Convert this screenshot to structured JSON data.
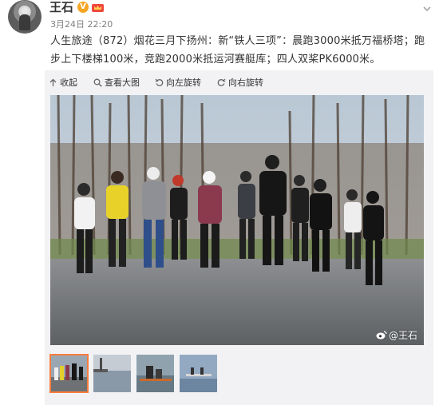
{
  "post": {
    "author": "王石",
    "verified_badge": "V",
    "timestamp": "3月24日 22:20",
    "text": "人生旅途（872）烟花三月下扬州：新“铁人三项”：晨跑3000米抵万福桥塔；跑步上下楼梯100米，竞跑2000米抵运河赛艇库；四人双桨PK6000米。"
  },
  "toolbar": {
    "collapse": "收起",
    "view_large": "查看大图",
    "rotate_left": "向左旋转",
    "rotate_right": "向右旋转"
  },
  "photo": {
    "watermark": "@王石"
  },
  "thumbnails": [
    {
      "label": "thumbnail-1",
      "selected": true
    },
    {
      "label": "thumbnail-2",
      "selected": false
    },
    {
      "label": "thumbnail-3",
      "selected": false
    },
    {
      "label": "thumbnail-4",
      "selected": false
    }
  ],
  "colors": {
    "accent": "#fa7d3c",
    "vip_badge": "#f5a623",
    "text": "#333333",
    "muted": "#808080",
    "media_bg": "#f2f2f5"
  },
  "icons": {
    "collapse": "collapse-arrow-icon",
    "view_large": "magnifier-icon",
    "rotate_left": "rotate-left-icon",
    "rotate_right": "rotate-right-icon",
    "more": "chevron-down-icon",
    "vip": "crown-icon",
    "weibo": "weibo-logo-icon"
  }
}
